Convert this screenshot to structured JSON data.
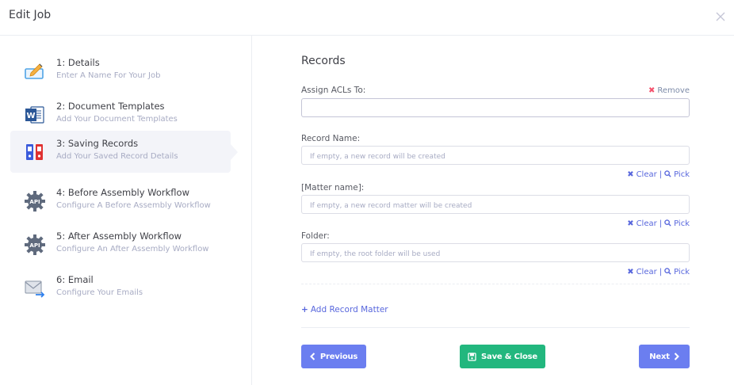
{
  "window": {
    "title": "Edit Job"
  },
  "steps": [
    {
      "title": "1: Details",
      "desc": "Enter A Name For Your Job",
      "icon": "pencil-icon"
    },
    {
      "title": "2: Document Templates",
      "desc": "Add Your Document Templates",
      "icon": "word-icon"
    },
    {
      "title": "3: Saving Records",
      "desc": "Add Your Saved Record Details",
      "icon": "binders-icon",
      "active": true
    },
    {
      "title": "4: Before Assembly Workflow",
      "desc": "Configure A Before Assembly Workflow",
      "icon": "api-gear-icon"
    },
    {
      "title": "5: After Assembly Workflow",
      "desc": "Configure An After Assembly Workflow",
      "icon": "api-gear-icon"
    },
    {
      "title": "6: Email",
      "desc": "Configure Your Emails",
      "icon": "email-icon"
    }
  ],
  "main": {
    "title": "Records",
    "acl": {
      "label": "Assign ACLs To:",
      "remove": "Remove",
      "value": ""
    },
    "record_name": {
      "label": "Record Name:",
      "placeholder": "If empty, a new record will be created"
    },
    "matter_name": {
      "label": "[Matter name]:",
      "placeholder": "If empty, a new record matter will be created"
    },
    "folder": {
      "label": "Folder:",
      "placeholder": "If empty, the root folder will be used"
    },
    "clear_label": "Clear",
    "pick_label": "Pick",
    "add_record_matter": "Add Record Matter"
  },
  "buttons": {
    "previous": "Previous",
    "save_close": "Save & Close",
    "next": "Next"
  },
  "colors": {
    "accent": "#5867dd",
    "success": "#22b77e",
    "danger": "#f4516c"
  }
}
